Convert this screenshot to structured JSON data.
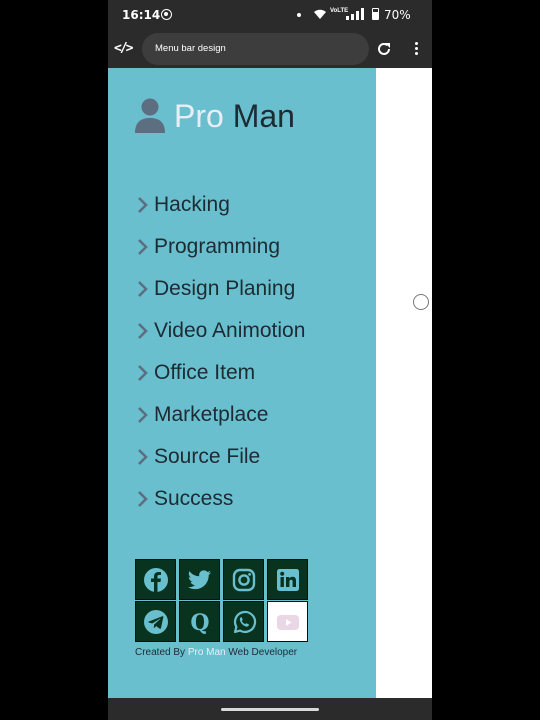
{
  "status_bar": {
    "time": "16:14",
    "volte": "VoLTE",
    "battery": "70%"
  },
  "browser": {
    "site_icon": "</>",
    "url": "Menu bar design"
  },
  "sidebar": {
    "bg_color": "#6abfcf",
    "brand_first": "Pro",
    "brand_last": "Man",
    "menu": [
      {
        "label": "Hacking"
      },
      {
        "label": "Programming"
      },
      {
        "label": "Design Planing"
      },
      {
        "label": "Video Animotion"
      },
      {
        "label": "Office Item"
      },
      {
        "label": "Marketplace"
      },
      {
        "label": "Source File"
      },
      {
        "label": "Success"
      }
    ],
    "social": [
      "facebook-icon",
      "twitter-icon",
      "instagram-icon",
      "linkedin-icon",
      "telegram-icon",
      "quora-icon",
      "whatsapp-icon",
      "youtube-icon"
    ],
    "credit_prefix": "Created By",
    "credit_name": "Pro Man",
    "credit_suffix": "Web Developer"
  }
}
